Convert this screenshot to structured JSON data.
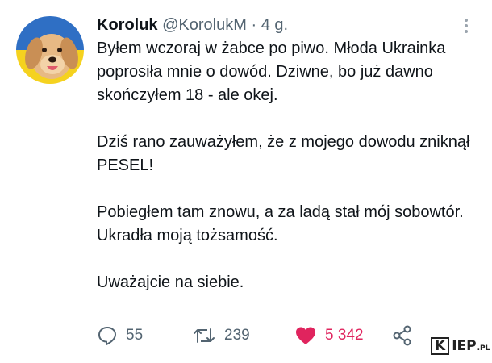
{
  "tweet": {
    "author": {
      "name": "Koroluk",
      "handle": "@KorolukM",
      "separator": "·",
      "time": "4 g.",
      "avatar_icon": "dog-avatar-icon"
    },
    "paragraphs": [
      "Byłem wczoraj w żabce po piwo. Młoda Ukrainka poprosiła mnie o dowód. Dziwne, bo już dawno skończyłem 18 - ale okej.",
      "Dziś rano zauważyłem, że z mojego dowodu zniknął PESEL!",
      "Pobiegłem tam znowu, a za ladą stał mój sobowtór. Ukradła moją tożsamość.",
      "Uważajcie na siebie."
    ],
    "actions": {
      "replies": "55",
      "retweets": "239",
      "likes": "5 342",
      "reply_icon": "reply-icon",
      "retweet_icon": "retweet-icon",
      "like_icon": "heart-icon",
      "share_icon": "share-icon"
    },
    "more_icon": "more-options-icon"
  },
  "watermark": {
    "first_letter": "K",
    "rest": "IEP",
    "suffix": ".PL"
  },
  "colors": {
    "like": "#e0245e",
    "muted": "#536471",
    "text": "#0f1419",
    "avatar_blue": "#2f6fc4",
    "avatar_yellow": "#f5d21f"
  }
}
